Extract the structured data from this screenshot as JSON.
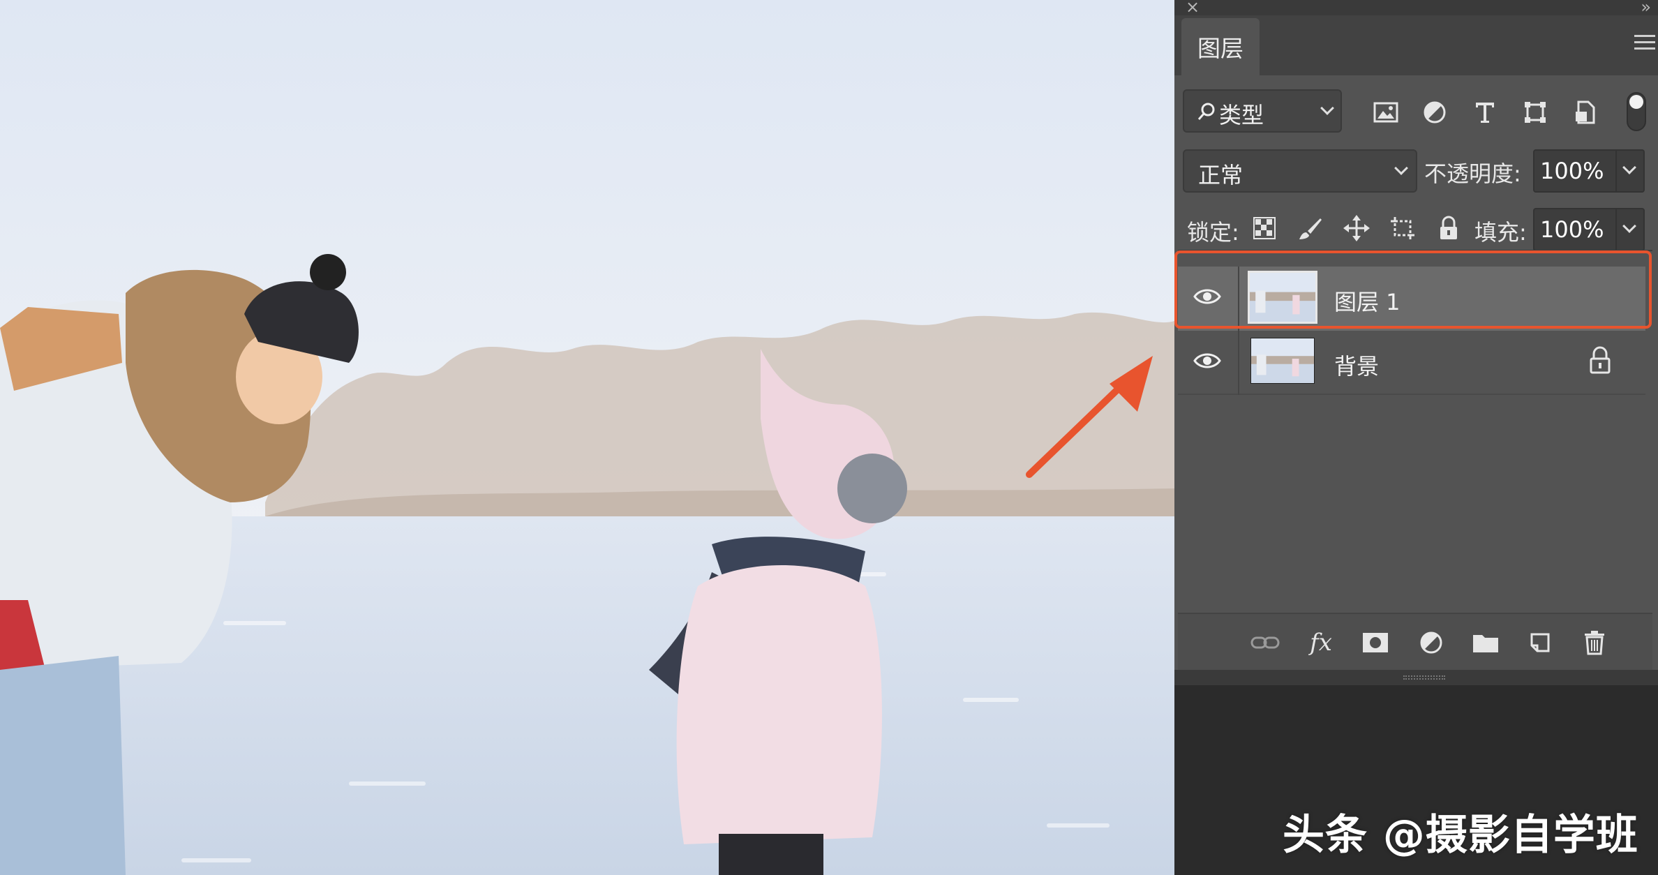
{
  "panel": {
    "tab_label": "图层",
    "filter": {
      "label": "类型"
    },
    "blend_mode": "正常",
    "opacity_label": "不透明度:",
    "opacity_value": "100%",
    "lock_label": "锁定:",
    "fill_label": "填充:",
    "fill_value": "100%",
    "layers": [
      {
        "name": "图层 1",
        "selected": true,
        "visible": true,
        "locked": false
      },
      {
        "name": "背景",
        "selected": false,
        "visible": true,
        "locked": true
      }
    ],
    "highlight_color": "#e8542e"
  },
  "watermark": "头条 @摄影自学班",
  "colors": {
    "accent": "#e8542e",
    "panel_bg": "#535353",
    "selected_row": "#6b6b6b"
  }
}
